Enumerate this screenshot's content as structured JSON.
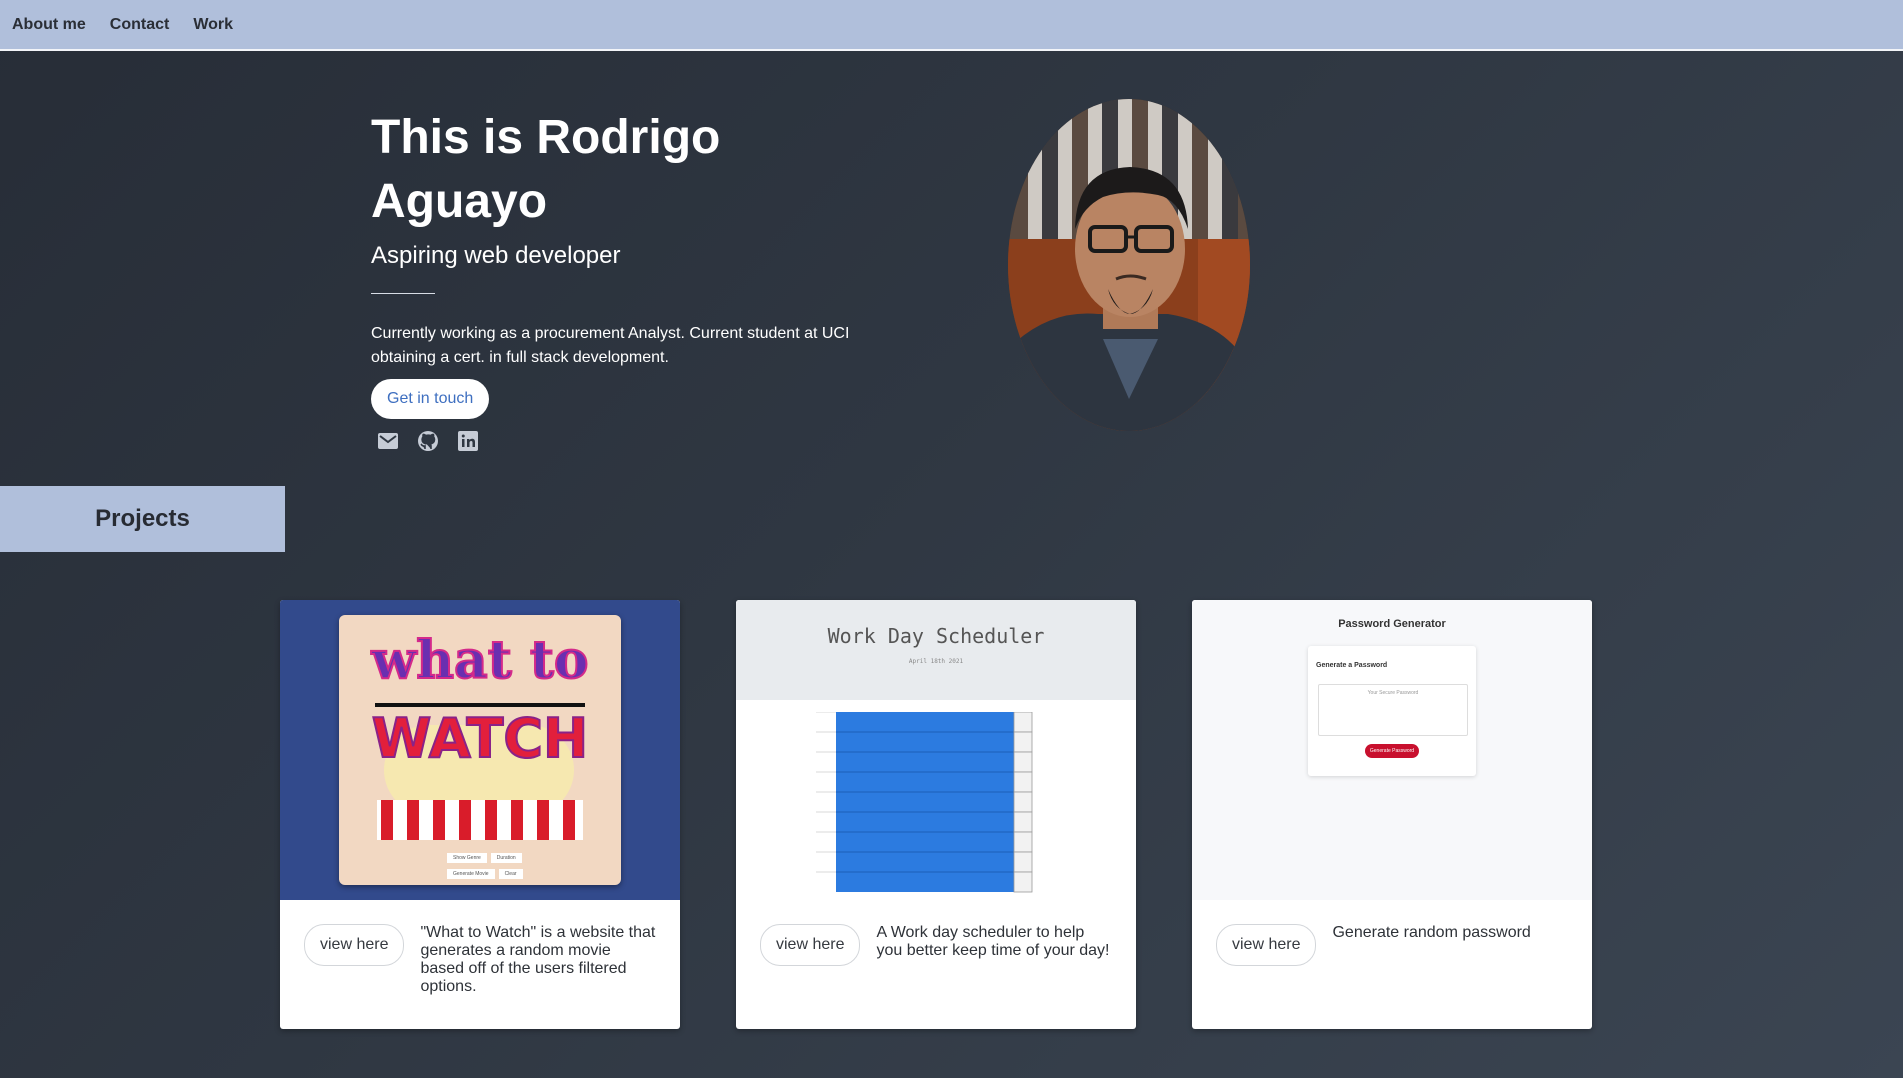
{
  "nav": {
    "items": [
      "About me",
      "Contact",
      "Work"
    ]
  },
  "hero": {
    "title": "This is Rodrigo Aguayo",
    "subtitle": "Aspiring web developer",
    "description": "Currently working as a procurement Analyst. Current student at UCI obtaining a cert. in full stack development.",
    "cta_label": "Get in touch",
    "socials": [
      "envelope-icon",
      "github-icon",
      "linkedin-icon"
    ]
  },
  "projects": {
    "heading": "Projects",
    "cards": [
      {
        "button": "view here",
        "description": "\"What to Watch\" is a website that generates a random movie based off of the users filtered options.",
        "preview": {
          "line1": "what to",
          "line2": "WATCH",
          "btn1": "Show Genre",
          "btn2": "Duration",
          "btn3": "Generate Movie",
          "btn4": "Clear"
        }
      },
      {
        "button": "view here",
        "description": "A Work day scheduler to help you better keep time of your day!",
        "preview": {
          "title": "Work Day Scheduler",
          "date": "April 18th 2021"
        }
      },
      {
        "button": "view here",
        "description": "Generate random password",
        "preview": {
          "title": "Password Generator",
          "subtitle": "Generate a Password",
          "placeholder": "Your Secure Password",
          "button": "Generate Password"
        }
      }
    ]
  },
  "colors": {
    "nav_bg": "#b0bfdb",
    "accent": "#3e6fc0",
    "scheduler_blue": "#2c7be0",
    "password_red": "#c8102e",
    "watch_bg": "#324a8c"
  }
}
